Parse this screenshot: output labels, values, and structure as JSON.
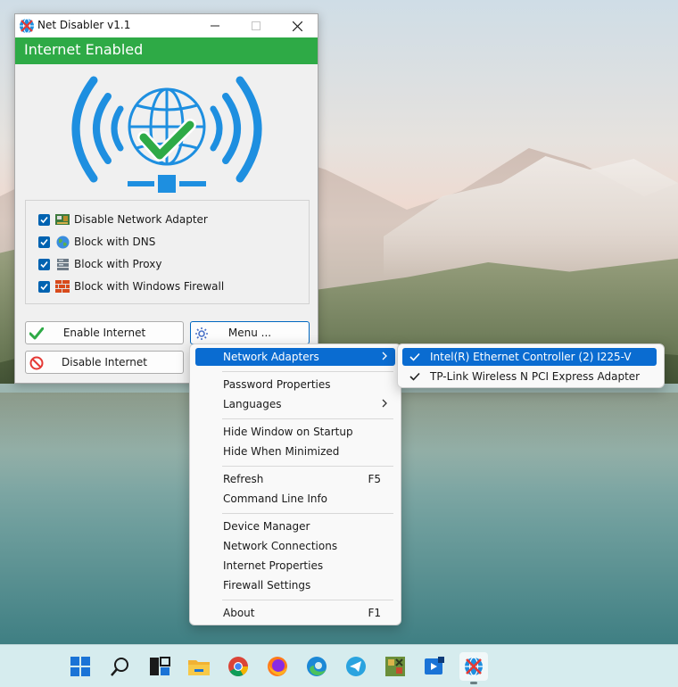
{
  "window": {
    "title": "Net Disabler v1.1",
    "status_text": "Internet Enabled",
    "status_color": "#2eaa46",
    "options": [
      {
        "label": "Disable Network Adapter",
        "checked": true,
        "icon": "network-card-icon"
      },
      {
        "label": "Block with DNS",
        "checked": true,
        "icon": "globe-icon"
      },
      {
        "label": "Block with Proxy",
        "checked": true,
        "icon": "proxy-server-icon"
      },
      {
        "label": "Block with Windows Firewall",
        "checked": true,
        "icon": "firewall-brick-icon"
      }
    ],
    "buttons": {
      "enable": "Enable Internet",
      "disable": "Disable Internet",
      "menu": "Menu ..."
    }
  },
  "menu": {
    "items": [
      {
        "label": "Network Adapters",
        "shortcut": "",
        "submenu": true
      },
      {
        "label": "Password Properties",
        "shortcut": "",
        "submenu": false
      },
      {
        "label": "Languages",
        "shortcut": "",
        "submenu": true
      },
      {
        "label": "Hide Window on Startup",
        "shortcut": "",
        "submenu": false
      },
      {
        "label": "Hide When Minimized",
        "shortcut": "",
        "submenu": false
      },
      {
        "label": "Refresh",
        "shortcut": "F5",
        "submenu": false
      },
      {
        "label": "Command Line Info",
        "shortcut": "",
        "submenu": false
      },
      {
        "label": "Device Manager",
        "shortcut": "",
        "submenu": false
      },
      {
        "label": "Network Connections",
        "shortcut": "",
        "submenu": false
      },
      {
        "label": "Internet Properties",
        "shortcut": "",
        "submenu": false
      },
      {
        "label": "Firewall Settings",
        "shortcut": "",
        "submenu": false
      },
      {
        "label": "About",
        "shortcut": "F1",
        "submenu": false
      }
    ]
  },
  "submenu": {
    "items": [
      {
        "label": "Intel(R) Ethernet Controller (2) I225-V",
        "checked": true
      },
      {
        "label": "TP-Link Wireless N PCI Express Adapter",
        "checked": true
      }
    ]
  },
  "taskbar": {
    "icons": [
      "windows-start-icon",
      "search-icon",
      "task-view-icon",
      "file-explorer-icon",
      "chrome-icon",
      "firefox-icon",
      "edge-icon",
      "telegram-icon",
      "game-app-icon",
      "media-player-icon",
      "net-disabler-icon"
    ]
  },
  "colors": {
    "accent": "#0a6cd1",
    "checkbox": "#0063b1",
    "wifi_blue": "#1e8fe0",
    "check_green": "#2eaa46"
  }
}
